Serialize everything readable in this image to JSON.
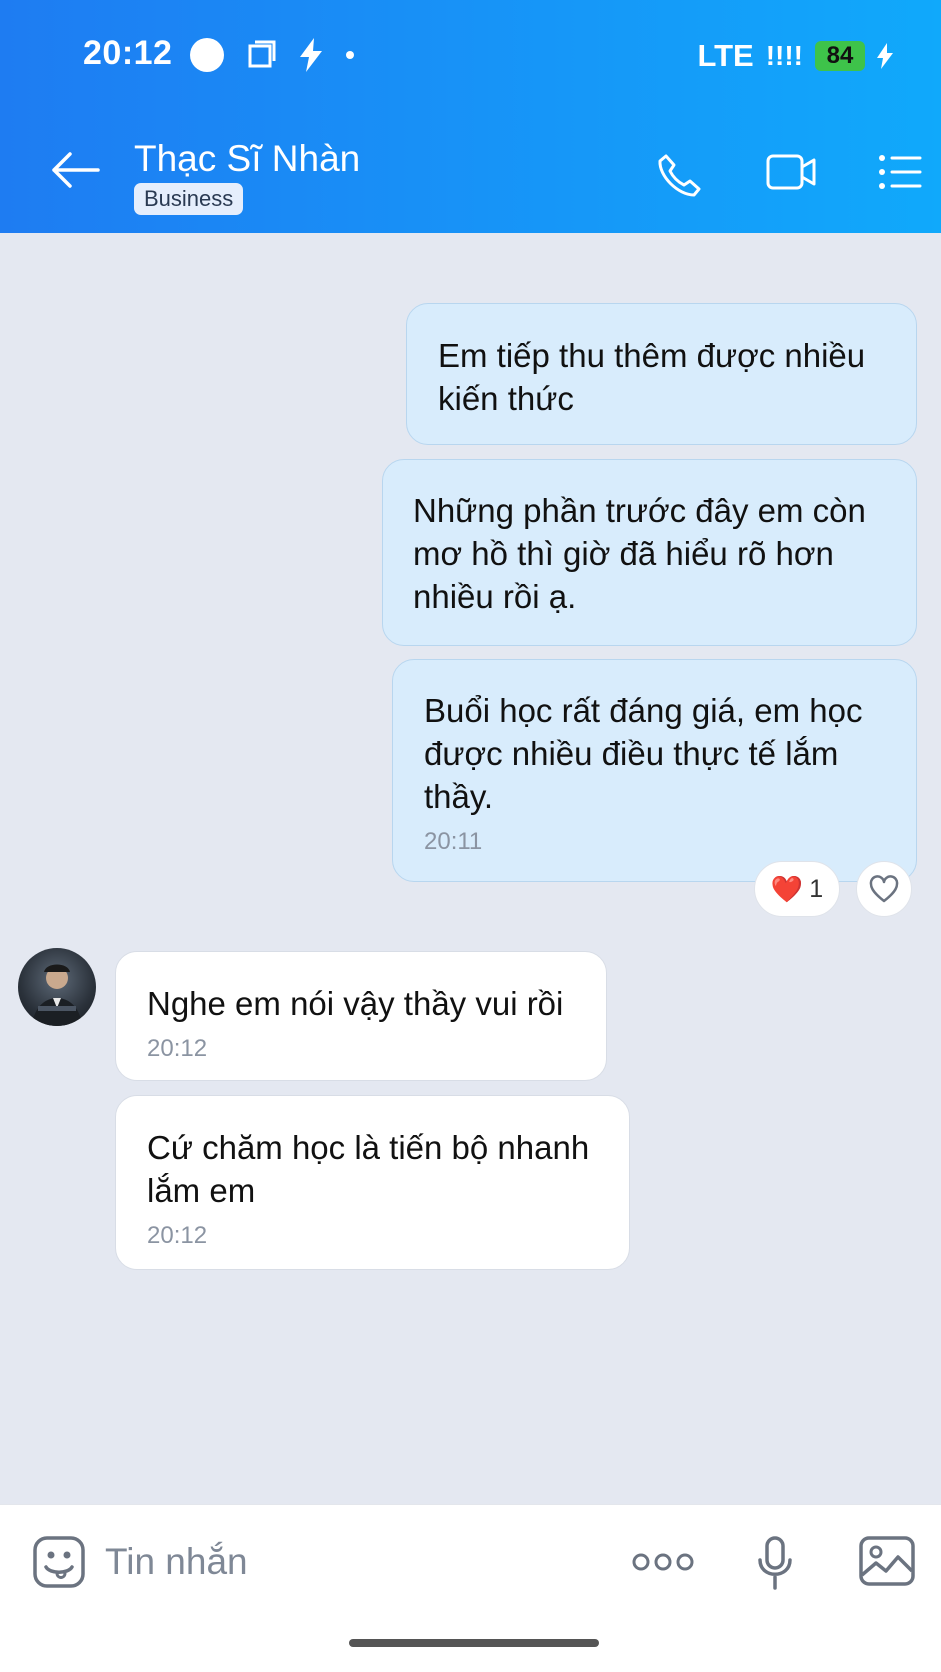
{
  "status_bar": {
    "time": "20:12",
    "network": "LTE",
    "signal": "!!!!",
    "battery": "84"
  },
  "header": {
    "title": "Thạc Sĩ Nhàn",
    "badge": "Business",
    "icons": [
      "back-arrow-icon",
      "phone-icon",
      "video-camera-icon",
      "menu-list-icon"
    ]
  },
  "messages": [
    {
      "side": "out",
      "text": "Em tiếp thu thêm được nhiều\nkiến thức"
    },
    {
      "side": "out",
      "text": "Những phần trước đây em còn\nmơ hồ thì giờ đã hiểu rõ hơn\nnhiều rồi ạ."
    },
    {
      "side": "out",
      "text": "Buổi học rất đáng giá, em học\nđược nhiều điều thực tế lắm\nthầy.",
      "time": "20:11"
    },
    {
      "side": "in",
      "text": "Nghe em nói vậy thầy vui rồi",
      "time": "20:12"
    },
    {
      "side": "in",
      "text": "Cứ chăm học là tiến bộ nhanh\nlắm em",
      "time": "20:12"
    }
  ],
  "reaction": {
    "emoji": "❤️",
    "count": "1"
  },
  "input": {
    "placeholder": "Tin nhắn"
  },
  "colors": {
    "header_start": "#1e7cf2",
    "header_end": "#10a9fb",
    "outgoing_bubble": "#d8ecfc",
    "incoming_bubble": "#ffffff",
    "background": "#e4e8f1"
  }
}
